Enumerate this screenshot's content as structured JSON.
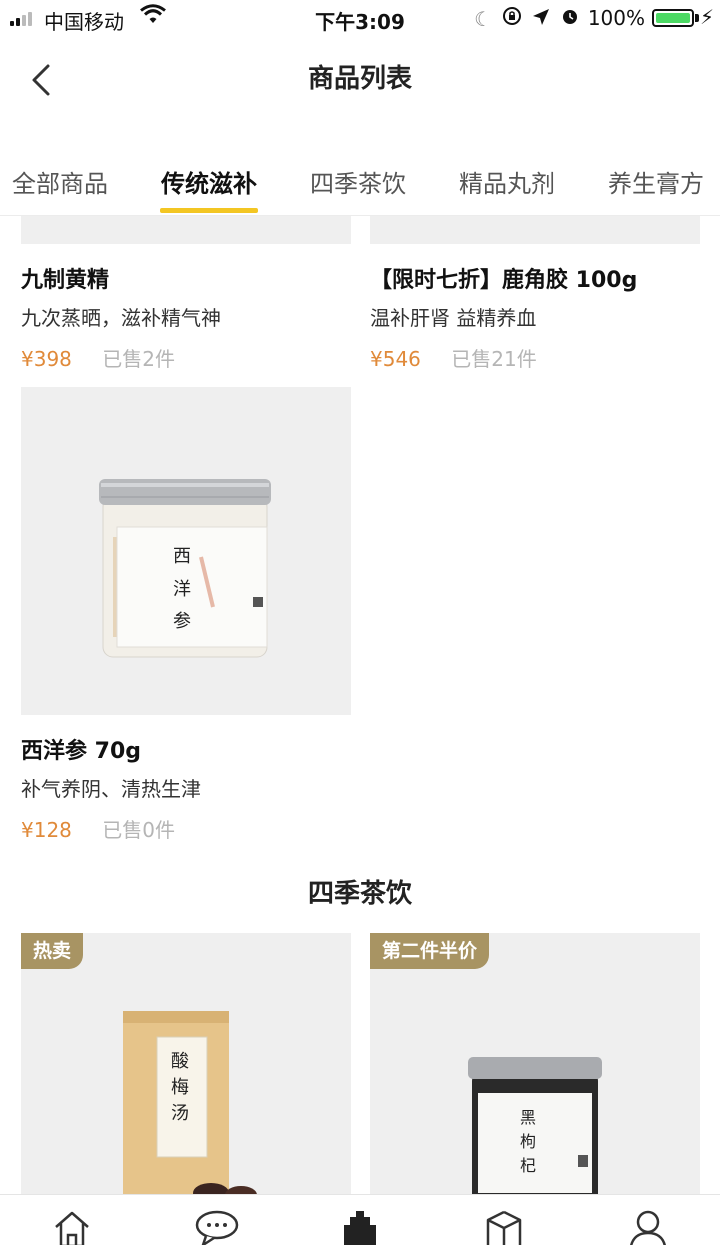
{
  "status_bar": {
    "carrier": "中国移动",
    "time": "下午3:09",
    "battery": "100%",
    "battery_level": 1.0
  },
  "header": {
    "title": "商品列表"
  },
  "tabs": [
    {
      "label": "全部商品",
      "active": false
    },
    {
      "label": "传统滋补",
      "active": true
    },
    {
      "label": "四季茶饮",
      "active": false
    },
    {
      "label": "精品丸剂",
      "active": false
    },
    {
      "label": "养生膏方",
      "active": false
    }
  ],
  "products": [
    {
      "name": "九制黄精",
      "desc": "九次蒸晒，滋补精气神",
      "price": "¥398",
      "sold": "已售2件"
    },
    {
      "name": "【限时七折】鹿角胶 100g",
      "desc": "温补肝肾 益精养血",
      "price": "¥546",
      "sold": "已售21件"
    },
    {
      "name": "西洋参 70g",
      "desc": "补气养阴、清热生津",
      "price": "¥128",
      "sold": "已售0件",
      "jar_label": "西洋参"
    }
  ],
  "section2": {
    "title": "四季茶饮",
    "cards": [
      {
        "badge": "热卖",
        "pack_label": "酸梅汤"
      },
      {
        "badge": "第二件半价",
        "jar_label": "黑枸杞"
      }
    ]
  },
  "colors": {
    "accent": "#f3c623",
    "price": "#e08a3a",
    "badge": "#a89463"
  },
  "bottom_nav": [
    "home-icon",
    "chat-icon",
    "shop-icon",
    "cube-icon",
    "user-icon"
  ]
}
